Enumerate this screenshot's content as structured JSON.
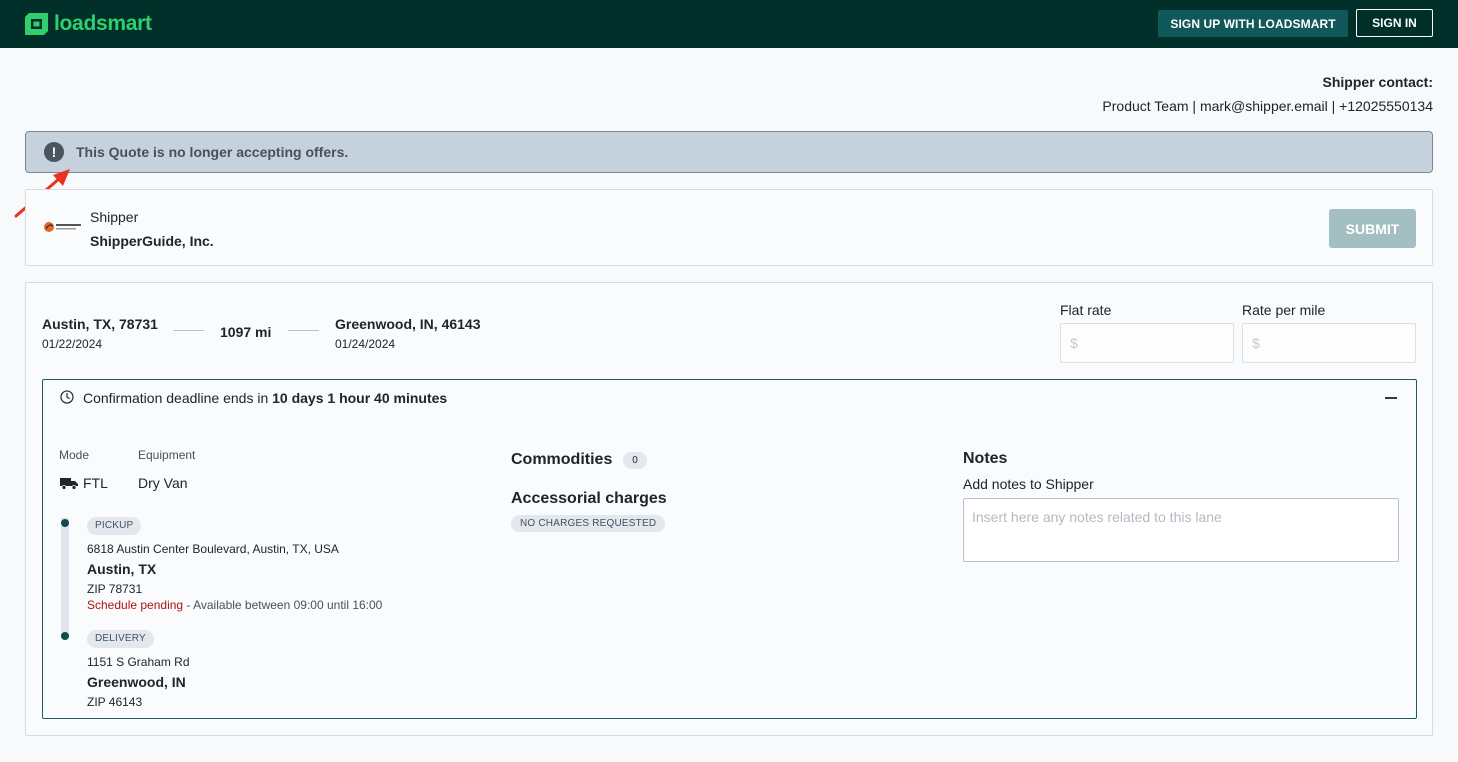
{
  "header": {
    "brand": "loadsmart",
    "signup_label": "SIGN UP WITH LOADSMART",
    "signin_label": "SIGN IN"
  },
  "contact": {
    "title": "Shipper contact:",
    "info": "Product Team | mark@shipper.email | +12025550134"
  },
  "alert": {
    "icon": "exclamation-circle-icon",
    "message": "This Quote is no longer accepting offers."
  },
  "shipper": {
    "label": "Shipper",
    "name": "ShipperGuide, Inc.",
    "submit_label": "SUBMIT"
  },
  "lane": {
    "origin": {
      "city": "Austin, TX, 78731",
      "date": "01/22/2024"
    },
    "distance": "1097 mi",
    "destination": {
      "city": "Greenwood, IN, 46143",
      "date": "01/24/2024"
    },
    "flat_rate": {
      "label": "Flat rate",
      "placeholder": "$"
    },
    "rate_per_mile": {
      "label": "Rate per mile",
      "placeholder": "$"
    }
  },
  "deadline": {
    "prefix": "Confirmation deadline ends in ",
    "remaining": "10 days 1 hour 40 minutes"
  },
  "details": {
    "mode_label": "Mode",
    "mode_value": "FTL",
    "equipment_label": "Equipment",
    "equipment_value": "Dry Van"
  },
  "stops": [
    {
      "type": "PICKUP",
      "address": "6818 Austin Center Boulevard, Austin, TX, USA",
      "city": "Austin, TX",
      "zip": "ZIP 78731",
      "schedule_status": "Schedule pending",
      "schedule_window": " - Available between 09:00 until 16:00"
    },
    {
      "type": "DELIVERY",
      "address": "1151 S Graham Rd",
      "city": "Greenwood, IN",
      "zip": "ZIP 46143"
    }
  ],
  "commodities": {
    "title": "Commodities",
    "count": "0"
  },
  "accessorials": {
    "title": "Accessorial charges",
    "badge": "NO CHARGES REQUESTED"
  },
  "notes": {
    "title": "Notes",
    "label": "Add notes to Shipper",
    "placeholder": "Insert here any notes related to this lane"
  },
  "colors": {
    "topbar": "#01302a",
    "brand_green": "#2fcf6e",
    "accent_teal": "#11585a",
    "alert_bg": "#c5d1dc",
    "pending_red": "#b01212",
    "annotation_arrow": "#e8341c"
  }
}
